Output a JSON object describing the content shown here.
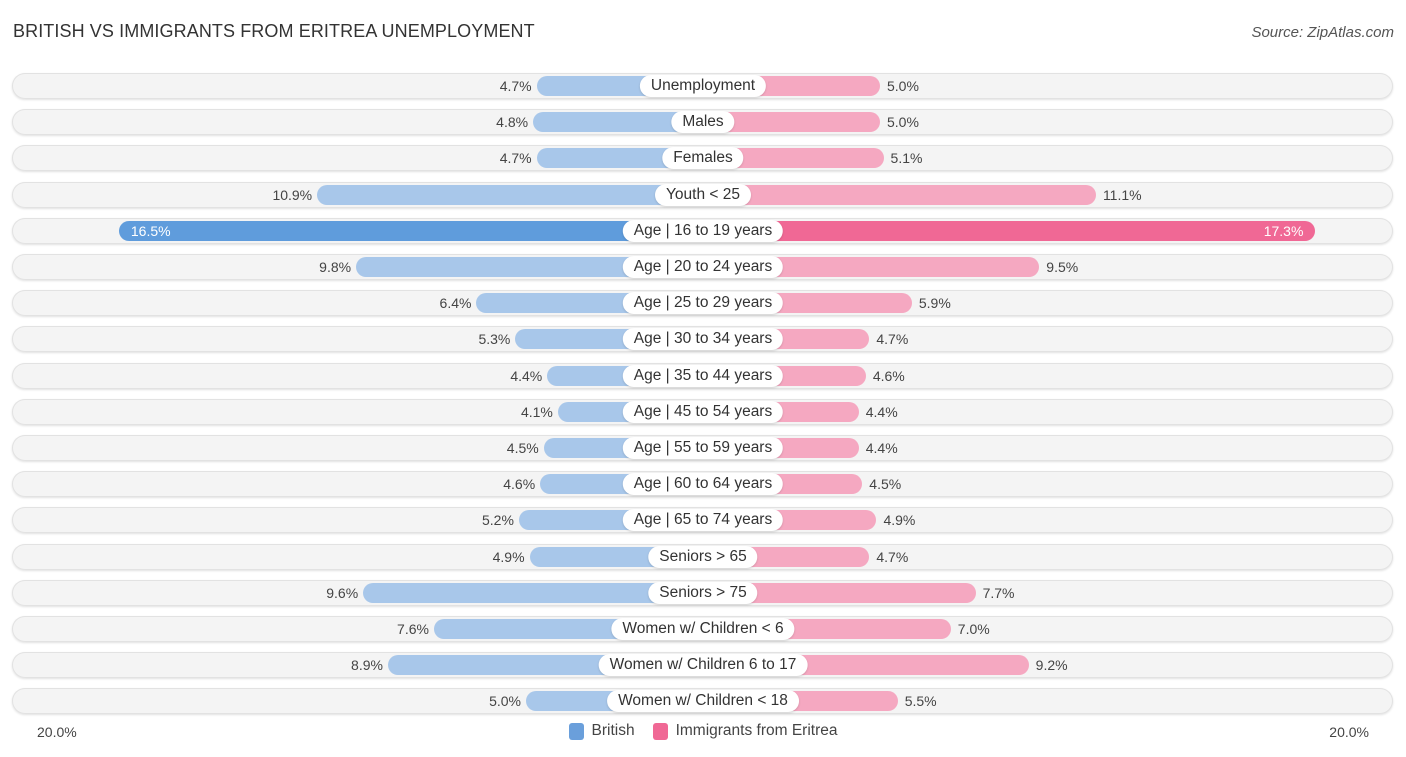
{
  "title": "BRITISH VS IMMIGRANTS FROM ERITREA UNEMPLOYMENT",
  "source": "Source: ZipAtlas.com",
  "colors": {
    "british": "#a8c7ea",
    "british_highlight": "#5f9cdc",
    "eritrea": "#f5a8c1",
    "eritrea_highlight": "#f06895",
    "legend_british": "#6a9fdb",
    "legend_eritrea": "#f06895"
  },
  "chart_data": {
    "type": "bar",
    "orientation": "horizontal-diverging",
    "title": "BRITISH VS IMMIGRANTS FROM ERITREA UNEMPLOYMENT",
    "xlim": [
      -20,
      20
    ],
    "axis_labels": {
      "left": "20.0%",
      "right": "20.0%"
    },
    "legend": [
      "British",
      "Immigrants from Eritrea"
    ],
    "legend_position": "bottom-center",
    "highlight_category": "Age | 16 to 19 years",
    "categories": [
      "Unemployment",
      "Males",
      "Females",
      "Youth < 25",
      "Age | 16 to 19 years",
      "Age | 20 to 24 years",
      "Age | 25 to 29 years",
      "Age | 30 to 34 years",
      "Age | 35 to 44 years",
      "Age | 45 to 54 years",
      "Age | 55 to 59 years",
      "Age | 60 to 64 years",
      "Age | 65 to 74 years",
      "Seniors > 65",
      "Seniors > 75",
      "Women w/ Children < 6",
      "Women w/ Children 6 to 17",
      "Women w/ Children < 18"
    ],
    "series": [
      {
        "name": "British",
        "values": [
          4.7,
          4.8,
          4.7,
          10.9,
          16.5,
          9.8,
          6.4,
          5.3,
          4.4,
          4.1,
          4.5,
          4.6,
          5.2,
          4.9,
          9.6,
          7.6,
          8.9,
          5.0
        ]
      },
      {
        "name": "Immigrants from Eritrea",
        "values": [
          5.0,
          5.0,
          5.1,
          11.1,
          17.3,
          9.5,
          5.9,
          4.7,
          4.6,
          4.4,
          4.4,
          4.5,
          4.9,
          4.7,
          7.7,
          7.0,
          9.2,
          5.5
        ]
      }
    ],
    "value_labels": {
      "British": [
        "4.7%",
        "4.8%",
        "4.7%",
        "10.9%",
        "16.5%",
        "9.8%",
        "6.4%",
        "5.3%",
        "4.4%",
        "4.1%",
        "4.5%",
        "4.6%",
        "5.2%",
        "4.9%",
        "9.6%",
        "7.6%",
        "8.9%",
        "5.0%"
      ],
      "Immigrants from Eritrea": [
        "5.0%",
        "5.0%",
        "5.1%",
        "11.1%",
        "17.3%",
        "9.5%",
        "5.9%",
        "4.7%",
        "4.6%",
        "4.4%",
        "4.4%",
        "4.5%",
        "4.9%",
        "4.7%",
        "7.7%",
        "7.0%",
        "9.2%",
        "5.5%"
      ]
    }
  }
}
